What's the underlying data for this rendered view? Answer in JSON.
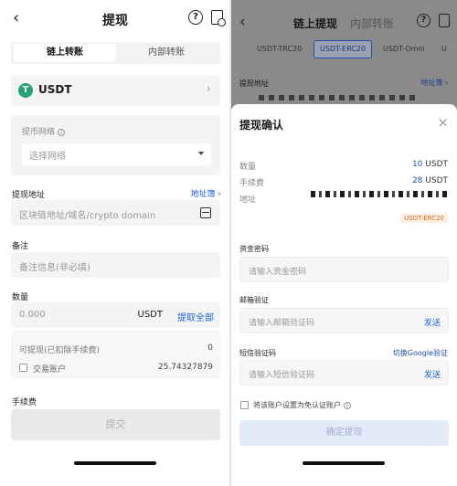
{
  "left": {
    "header": {
      "back_icon": "‹",
      "title": "提现",
      "help_icon": "?",
      "record_icon": "history-icon"
    },
    "tabs": [
      "链上转账",
      "内部转账"
    ],
    "coin": {
      "name": "USDT",
      "icon_letter": "T",
      "icon_color": "#26a17b"
    },
    "network": {
      "label": "提币网络",
      "placeholder": "选择网络"
    },
    "address": {
      "label": "提现地址",
      "book_link": "地址簿",
      "placeholder": "区块链地址/域名/crypto domain"
    },
    "memo": {
      "label": "备注",
      "placeholder": "备注信息(非必填)"
    },
    "amount": {
      "label": "数量",
      "placeholder": "0.000",
      "unit": "USDT",
      "all_button": "提取全部",
      "available_label": "可提现(已扣除手续费)",
      "available_value": "0",
      "trade_account_label": "交易账户",
      "trade_account_value": "25.74327879"
    },
    "fee_label": "手续费",
    "submit_label": "提交"
  },
  "right": {
    "header": {
      "tab_active": "链上提现",
      "tab_inactive": "内部转账"
    },
    "networks": [
      "USDT-TRC20",
      "USDT-ERC20",
      "USDT-Omni",
      "U"
    ],
    "selected_network_index": 1,
    "address_label": "提现地址",
    "address_book": "地址簿",
    "modal": {
      "title": "提现确认",
      "close": "×",
      "qty_label": "数量",
      "qty_value": "10",
      "qty_unit": "USDT",
      "fee_label": "手续费",
      "fee_value": "28",
      "fee_unit": "USDT",
      "addr_label": "地址",
      "network_tag": "USDT-ERC20",
      "fund_pwd_label": "资金密码",
      "fund_pwd_placeholder": "请输入资金密码",
      "email_label": "邮箱验证",
      "email_placeholder": "请输入邮箱验证码",
      "email_send": "发送",
      "sms_label": "短信验证码",
      "sms_switch": "切换Google验证",
      "sms_placeholder": "请输入短信验证码",
      "sms_send": "发送",
      "exempt_label": "将该账户设置为免认证账户",
      "confirm": "确定提现"
    }
  },
  "colors": {
    "accent": "#1f63d9",
    "usdt": "#26a17b",
    "tag": "#c46a1a",
    "overlay": "#8a8a8a"
  }
}
